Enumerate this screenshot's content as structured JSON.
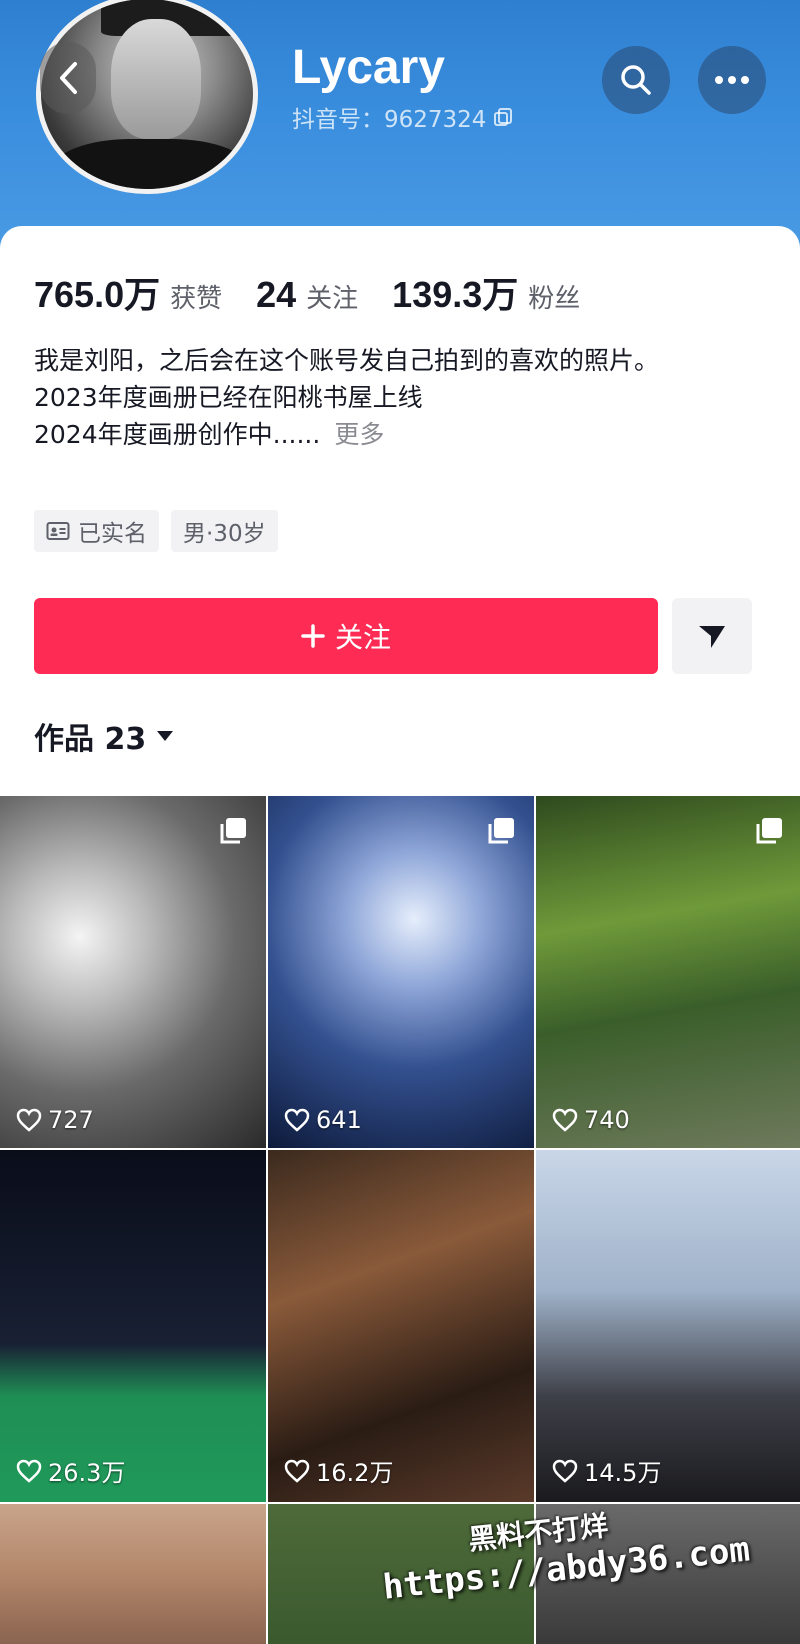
{
  "header": {
    "username": "Lycary",
    "douyin_id": "抖音号：9627324"
  },
  "stats": [
    {
      "value": "765.0万",
      "label": "获赞"
    },
    {
      "value": "24",
      "label": "关注"
    },
    {
      "value": "139.3万",
      "label": "粉丝"
    }
  ],
  "bio": {
    "lines": [
      "我是刘阳，之后会在这个账号发自己拍到的喜欢的照片。",
      "2023年度画册已经在阳桃书屋上线",
      "2024年度画册创作中......"
    ],
    "more": "更多"
  },
  "tags": {
    "verified": "已实名",
    "gender_age": "男·30岁"
  },
  "actions": {
    "follow_label": "关注"
  },
  "works_tab": {
    "label": "作品 23"
  },
  "posts": [
    {
      "likes": "727",
      "multi": true
    },
    {
      "likes": "641",
      "multi": true
    },
    {
      "likes": "740",
      "multi": true
    },
    {
      "likes": "26.3万",
      "multi": false
    },
    {
      "likes": "16.2万",
      "multi": false
    },
    {
      "likes": "14.5万",
      "multi": false
    }
  ],
  "watermark": {
    "line1": "黑料不打烊",
    "line2": "https://abdy36.com"
  },
  "colors": {
    "accent": "#fe2c55",
    "header_blue": "#3a8ede"
  }
}
